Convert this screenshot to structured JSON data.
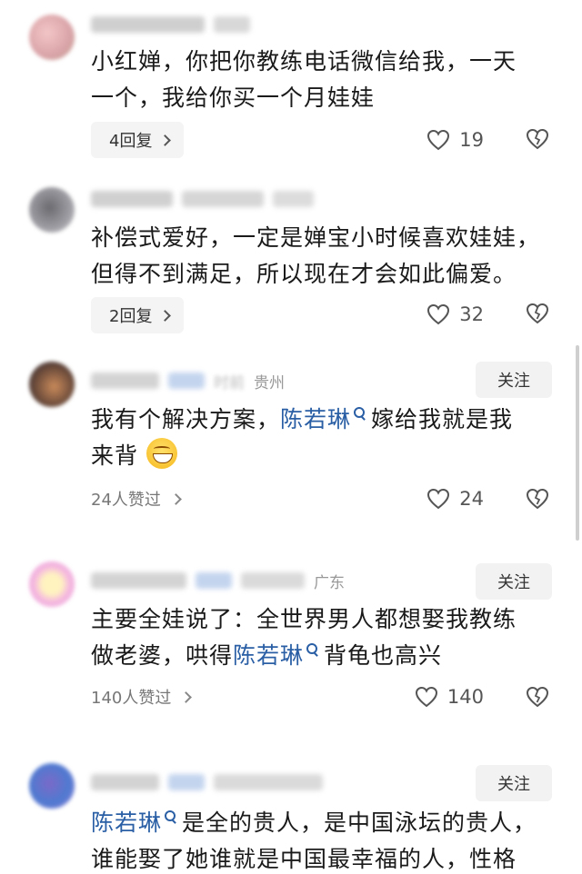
{
  "comments": [
    {
      "text_line1": "小红婵，你把你教练电话微信给我，一天",
      "text_line2": "一个，我给你买一个月娃娃",
      "reply_count": "4回复",
      "likes": "19"
    },
    {
      "text_line1": "补偿式爱好，一定是婵宝小时候喜欢娃娃，",
      "text_line2": "但得不到满足，所以现在才会如此偏爱。",
      "reply_count": "2回复",
      "likes": "32"
    },
    {
      "location": "贵州",
      "follow": "关注",
      "text_a": "我有个解决方案，",
      "mention": "陈若琳",
      "text_b": "嫁给我就是我",
      "text_line2": "来背",
      "likers": "24人赞过",
      "likes": "24"
    },
    {
      "location": "广东",
      "follow": "关注",
      "text_line1": "主要全娃说了：全世界男人都想娶我教练",
      "text_a": "做老婆，哄得",
      "mention": "陈若琳",
      "text_b": "背龟也高兴",
      "likers": "140人赞过",
      "likes": "140"
    },
    {
      "follow": "关注",
      "mention": "陈若琳",
      "text_a": "是全的贵人，是中国泳坛的贵人，",
      "text_line2": "谁能娶了她谁就是中国最幸福的人，性格"
    }
  ],
  "icons": {
    "like": "heart-outline-icon",
    "dislike": "broken-heart-icon",
    "chevron": "chevron-right-icon",
    "mention": "search-mention-icon",
    "emoji": "grinning-face-emoji"
  },
  "colors": {
    "mention": "#2a5fa5",
    "meta_text": "#999999",
    "pill_bg": "#f4f4f4"
  }
}
